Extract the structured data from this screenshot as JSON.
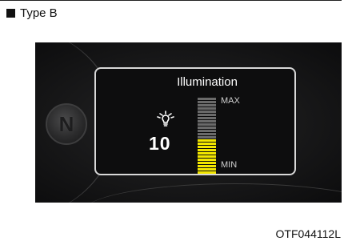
{
  "caption": {
    "text": "Type B"
  },
  "display": {
    "title": "Illumination",
    "level": "10",
    "max_label": "MAX",
    "min_label": "MIN",
    "level_fraction": 0.45,
    "active_color": "#f2e600",
    "inactive_color": "#6a6a6a"
  },
  "knob": {
    "icon": "n-knob-icon"
  },
  "figure_code": "OTF044112L"
}
